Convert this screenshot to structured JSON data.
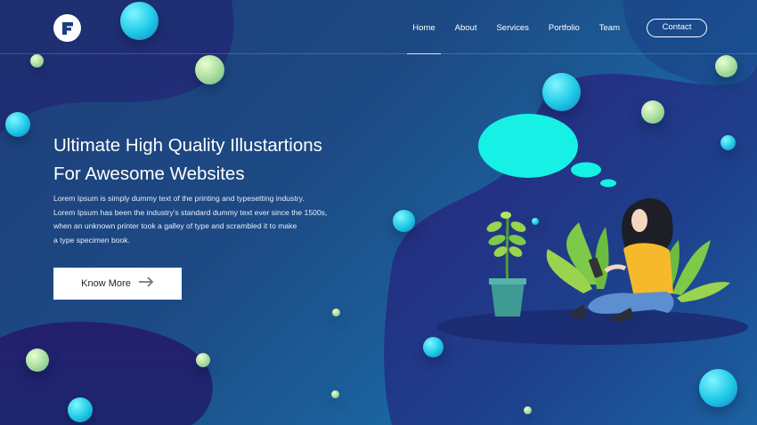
{
  "brand": {
    "logo_letter": "F"
  },
  "nav": {
    "items": [
      {
        "label": "Home",
        "active": true
      },
      {
        "label": "About",
        "active": false
      },
      {
        "label": "Services",
        "active": false
      },
      {
        "label": "Portfolio",
        "active": false
      },
      {
        "label": "Team",
        "active": false
      }
    ],
    "contact_label": "Contact"
  },
  "hero": {
    "title_line1": "Ultimate High Quality Illustartions",
    "title_line2": "For Awesome Websites",
    "body_lines": [
      "Lorem Ipsum is simply dummy text of the printing and typesetting industry.",
      "Lorem Ipsum has been the industry's standard dummy text ever since the 1500s,",
      "when an unknown printer took a galley of type and scrambled it to make",
      "a type specimen book."
    ],
    "button_label": "Know More",
    "button_icon": "arrow-right-icon"
  },
  "colors": {
    "accent_cyan": "#17f0e4",
    "shirt_yellow": "#f6b92b",
    "pants_blue": "#5b8fd0",
    "pot_teal": "#3f9a94",
    "leaf_green": "#7ec94a"
  }
}
